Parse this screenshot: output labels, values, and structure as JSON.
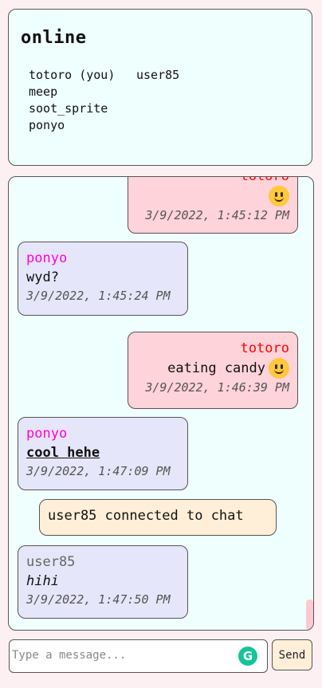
{
  "online": {
    "title": "online",
    "users": [
      "totoro (you)",
      "user85",
      "meep",
      "soot_sprite",
      "ponyo"
    ]
  },
  "messages": [
    {
      "type": "self",
      "author": "totoro",
      "text": "",
      "emoji": "smiley",
      "timestamp": "3/9/2022, 1:45:12 PM"
    },
    {
      "type": "other",
      "author": "ponyo",
      "text": "wyd?",
      "timestamp": "3/9/2022, 1:45:24 PM"
    },
    {
      "type": "self",
      "author": "totoro",
      "text": "eating candy",
      "emoji": "smiley",
      "timestamp": "3/9/2022, 1:46:39 PM"
    },
    {
      "type": "other",
      "author": "ponyo",
      "text": "cool hehe",
      "style": "bold-underline",
      "timestamp": "3/9/2022, 1:47:09 PM"
    },
    {
      "type": "system",
      "text": "user85 connected to chat"
    },
    {
      "type": "other",
      "author": "user85",
      "text": "hihi",
      "style": "italic",
      "timestamp": "3/9/2022, 1:47:50 PM"
    }
  ],
  "composer": {
    "placeholder": "Type a message...",
    "value": "",
    "send_label": "Send",
    "extension_icon": "grammarly-icon"
  },
  "colors": {
    "panel_bg": "#effffd",
    "page_bg": "#fdf0f3",
    "self_bubble": "#ffd3da",
    "other_bubble": "#e6e6fa",
    "system_bubble": "#ffefd8",
    "author_totoro": "#ff0000",
    "author_ponyo": "#ff00d6",
    "author_user85": "#666666"
  }
}
